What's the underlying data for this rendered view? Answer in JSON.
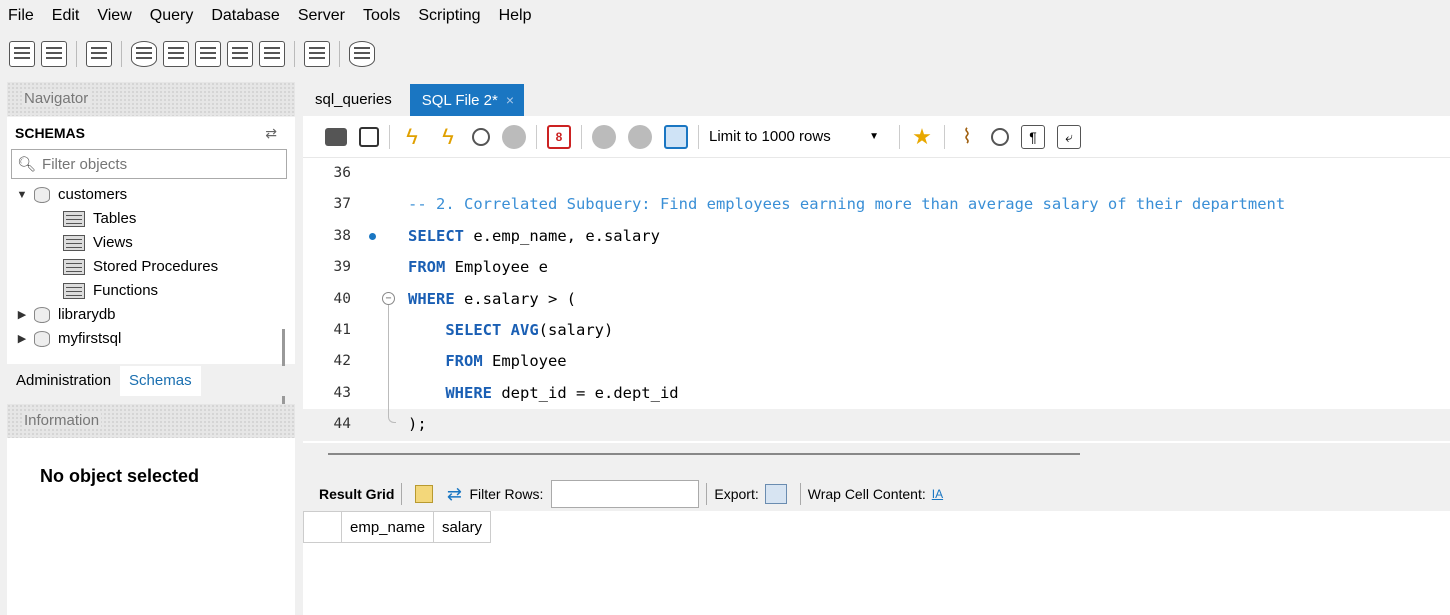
{
  "menu": [
    "File",
    "Edit",
    "View",
    "Query",
    "Database",
    "Server",
    "Tools",
    "Scripting",
    "Help"
  ],
  "main_toolbar_icons": [
    "new-sql-tab-icon",
    "open-sql-script-icon",
    "inspector-icon",
    "create-schema-icon",
    "create-table-icon",
    "create-view-icon",
    "create-procedure-icon",
    "create-function-icon",
    "search-table-data-icon",
    "reconnect-icon"
  ],
  "navigator": {
    "title": "Navigator",
    "schemas_label": "SCHEMAS",
    "filter_placeholder": "Filter objects",
    "tree": [
      {
        "name": "customers",
        "expanded": true,
        "children": [
          "Tables",
          "Views",
          "Stored Procedures",
          "Functions"
        ]
      },
      {
        "name": "librarydb",
        "expanded": false
      },
      {
        "name": "myfirstsql",
        "expanded": false
      }
    ],
    "tabs": [
      "Administration",
      "Schemas"
    ],
    "active_tab": "Schemas",
    "info_title": "Information",
    "no_object": "No object selected"
  },
  "editor": {
    "tabs": [
      {
        "label": "sql_queries",
        "active": false
      },
      {
        "label": "SQL File 2*",
        "active": true,
        "close": "×"
      }
    ],
    "limit_rows": "Limit to 1000 rows",
    "code_lines": [
      {
        "num": "36",
        "segments": []
      },
      {
        "num": "37",
        "segments": [
          {
            "t": "cm",
            "v": "-- 2. Correlated Subquery: Find employees earning more than average salary of their department"
          }
        ]
      },
      {
        "num": "38",
        "breakpoint": true,
        "segments": [
          {
            "t": "kw",
            "v": "SELECT"
          },
          {
            "t": "tx",
            "v": " e.emp_name, e.salary"
          }
        ]
      },
      {
        "num": "39",
        "segments": [
          {
            "t": "kw",
            "v": "FROM"
          },
          {
            "t": "tx",
            "v": " Employee e"
          }
        ]
      },
      {
        "num": "40",
        "fold": "start",
        "segments": [
          {
            "t": "kw",
            "v": "WHERE"
          },
          {
            "t": "tx",
            "v": " e.salary > ("
          }
        ]
      },
      {
        "num": "41",
        "fold": "mid",
        "segments": [
          {
            "t": "tx",
            "v": "    "
          },
          {
            "t": "kw",
            "v": "SELECT"
          },
          {
            "t": "tx",
            "v": " "
          },
          {
            "t": "kw",
            "v": "AVG"
          },
          {
            "t": "tx",
            "v": "(salary)"
          }
        ]
      },
      {
        "num": "42",
        "fold": "mid",
        "segments": [
          {
            "t": "tx",
            "v": "    "
          },
          {
            "t": "kw",
            "v": "FROM"
          },
          {
            "t": "tx",
            "v": " Employee"
          }
        ]
      },
      {
        "num": "43",
        "fold": "mid",
        "segments": [
          {
            "t": "tx",
            "v": "    "
          },
          {
            "t": "kw",
            "v": "WHERE"
          },
          {
            "t": "tx",
            "v": " dept_id = e.dept_id"
          }
        ]
      },
      {
        "num": "44",
        "fold": "end",
        "current": true,
        "segments": [
          {
            "t": "tx",
            "v": ");"
          }
        ]
      }
    ]
  },
  "result": {
    "grid_label": "Result Grid",
    "filter_label": "Filter Rows:",
    "export_label": "Export:",
    "wrap_label": "Wrap Cell Content:",
    "columns": [
      "emp_name",
      "salary"
    ]
  }
}
